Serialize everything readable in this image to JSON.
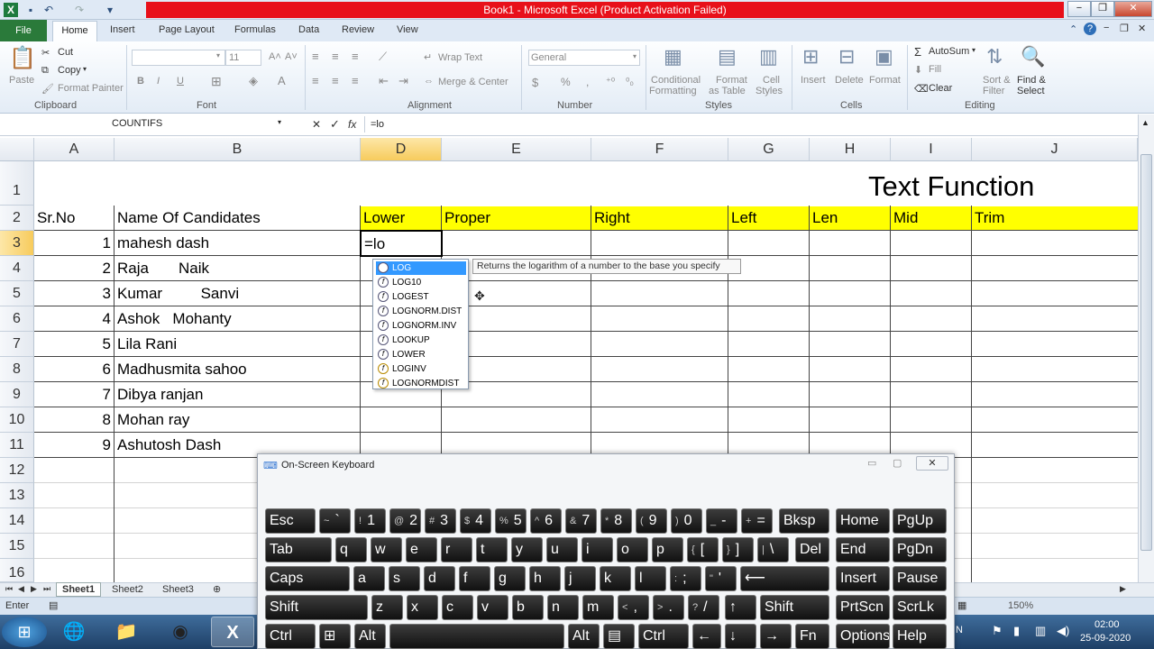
{
  "window": {
    "title": "Book1  -  Microsoft Excel (Product Activation Failed)"
  },
  "ribbon_tabs": [
    "File",
    "Home",
    "Insert",
    "Page Layout",
    "Formulas",
    "Data",
    "Review",
    "View"
  ],
  "clipboard": {
    "paste": "Paste",
    "cut": "Cut",
    "copy": "Copy",
    "format_painter": "Format Painter",
    "group": "Clipboard"
  },
  "font": {
    "size": "11",
    "bold": "B",
    "italic": "I",
    "underline": "U",
    "group": "Font"
  },
  "alignment": {
    "wrap": "Wrap Text",
    "merge": "Merge & Center",
    "group": "Alignment"
  },
  "number": {
    "format": "General",
    "percent": "%",
    "comma": ",",
    "group": "Number"
  },
  "styles": {
    "conditional": "Conditional",
    "conditional2": "Formatting",
    "format_as": "Format",
    "format_as2": "as Table",
    "cell": "Cell",
    "cell2": "Styles",
    "group": "Styles"
  },
  "cells": {
    "insert": "Insert",
    "delete": "Delete",
    "format": "Format",
    "group": "Cells"
  },
  "editing": {
    "autosum": "AutoSum",
    "fill": "Fill",
    "clear": "Clear",
    "sort": "Sort &",
    "sort2": "Filter",
    "find": "Find &",
    "find2": "Select",
    "group": "Editing"
  },
  "formula_bar": {
    "name_box": "COUNTIFS",
    "cancel": "✕",
    "enter": "✓",
    "fx": "fx",
    "value": "=lo"
  },
  "columns": [
    "A",
    "B",
    "D",
    "E",
    "F",
    "G",
    "H",
    "I",
    "J"
  ],
  "rows": [
    "1",
    "2",
    "3",
    "4",
    "5",
    "6",
    "7",
    "8",
    "9",
    "10",
    "11",
    "12",
    "13",
    "14",
    "15",
    "16"
  ],
  "title_cell": "Text Function",
  "headers": {
    "srno": "Sr.No",
    "name": "Name Of Candidates",
    "lower": "Lower",
    "proper": "Proper",
    "right": "Right",
    "left": "Left",
    "len": "Len",
    "mid": "Mid",
    "trim": "Trim"
  },
  "candidates": [
    {
      "no": "1",
      "name": "mahesh dash"
    },
    {
      "no": "2",
      "name": "Raja       Naik"
    },
    {
      "no": "3",
      "name": "Kumar         Sanvi"
    },
    {
      "no": "4",
      "name": "Ashok   Mohanty"
    },
    {
      "no": "5",
      "name": "Lila Rani"
    },
    {
      "no": "6",
      "name": "Madhusmita sahoo"
    },
    {
      "no": "7",
      "name": "Dibya ranjan"
    },
    {
      "no": "8",
      "name": "Mohan ray"
    },
    {
      "no": "9",
      "name": "Ashutosh Dash"
    }
  ],
  "edit_cell": "=lo",
  "autocomplete": [
    "LOG",
    "LOG10",
    "LOGEST",
    "LOGNORM.DIST",
    "LOGNORM.INV",
    "LOOKUP",
    "LOWER",
    "LOGINV",
    "LOGNORMDIST"
  ],
  "tooltip": "Returns the logarithm of a number to the base you specify",
  "sheets": [
    "Sheet1",
    "Sheet2",
    "Sheet3"
  ],
  "status": {
    "mode": "Enter",
    "zoom": "150%"
  },
  "osk": {
    "title": "On-Screen Keyboard"
  },
  "tray": {
    "time": "02:00",
    "date": "25-09-2020",
    "lang": "N"
  },
  "keys": {
    "esc": "Esc",
    "bksp": "Bksp",
    "home": "Home",
    "pgup": "PgUp",
    "tab": "Tab",
    "del": "Del",
    "end": "End",
    "pgdn": "PgDn",
    "caps": "Caps",
    "insert": "Insert",
    "pause": "Pause",
    "shift": "Shift",
    "shift2": "Shift",
    "prtscn": "PrtScn",
    "scrlk": "ScrLk",
    "ctrl": "Ctrl",
    "alt": "Alt",
    "alt2": "Alt",
    "ctrl2": "Ctrl",
    "fn": "Fn",
    "options": "Options",
    "help": "Help",
    "num": [
      [
        "~",
        "`"
      ],
      [
        "!",
        "1"
      ],
      [
        "@",
        "2"
      ],
      [
        "#",
        "3"
      ],
      [
        "$",
        "4"
      ],
      [
        "%",
        "5"
      ],
      [
        "^",
        "6"
      ],
      [
        "&",
        "7"
      ],
      [
        "*",
        "8"
      ],
      [
        "(",
        "9"
      ],
      [
        ")",
        "0"
      ],
      [
        "_",
        "-"
      ],
      [
        "+",
        "="
      ]
    ],
    "q": [
      "q",
      "w",
      "e",
      "r",
      "t",
      "y",
      "u",
      "i",
      "o",
      "p"
    ],
    "bracket": [
      [
        "{",
        "["
      ],
      [
        "}",
        "]"
      ],
      [
        "|",
        "\\"
      ]
    ],
    "a": [
      "a",
      "s",
      "d",
      "f",
      "g",
      "h",
      "j",
      "k",
      "l"
    ],
    "semi": [
      [
        ":",
        ";"
      ],
      [
        "\"",
        "'"
      ]
    ],
    "z": [
      "z",
      "x",
      "c",
      "v",
      "b",
      "n",
      "m"
    ],
    "punct": [
      [
        "<",
        ","
      ],
      [
        ">",
        "."
      ],
      [
        "?",
        "/"
      ]
    ]
  }
}
